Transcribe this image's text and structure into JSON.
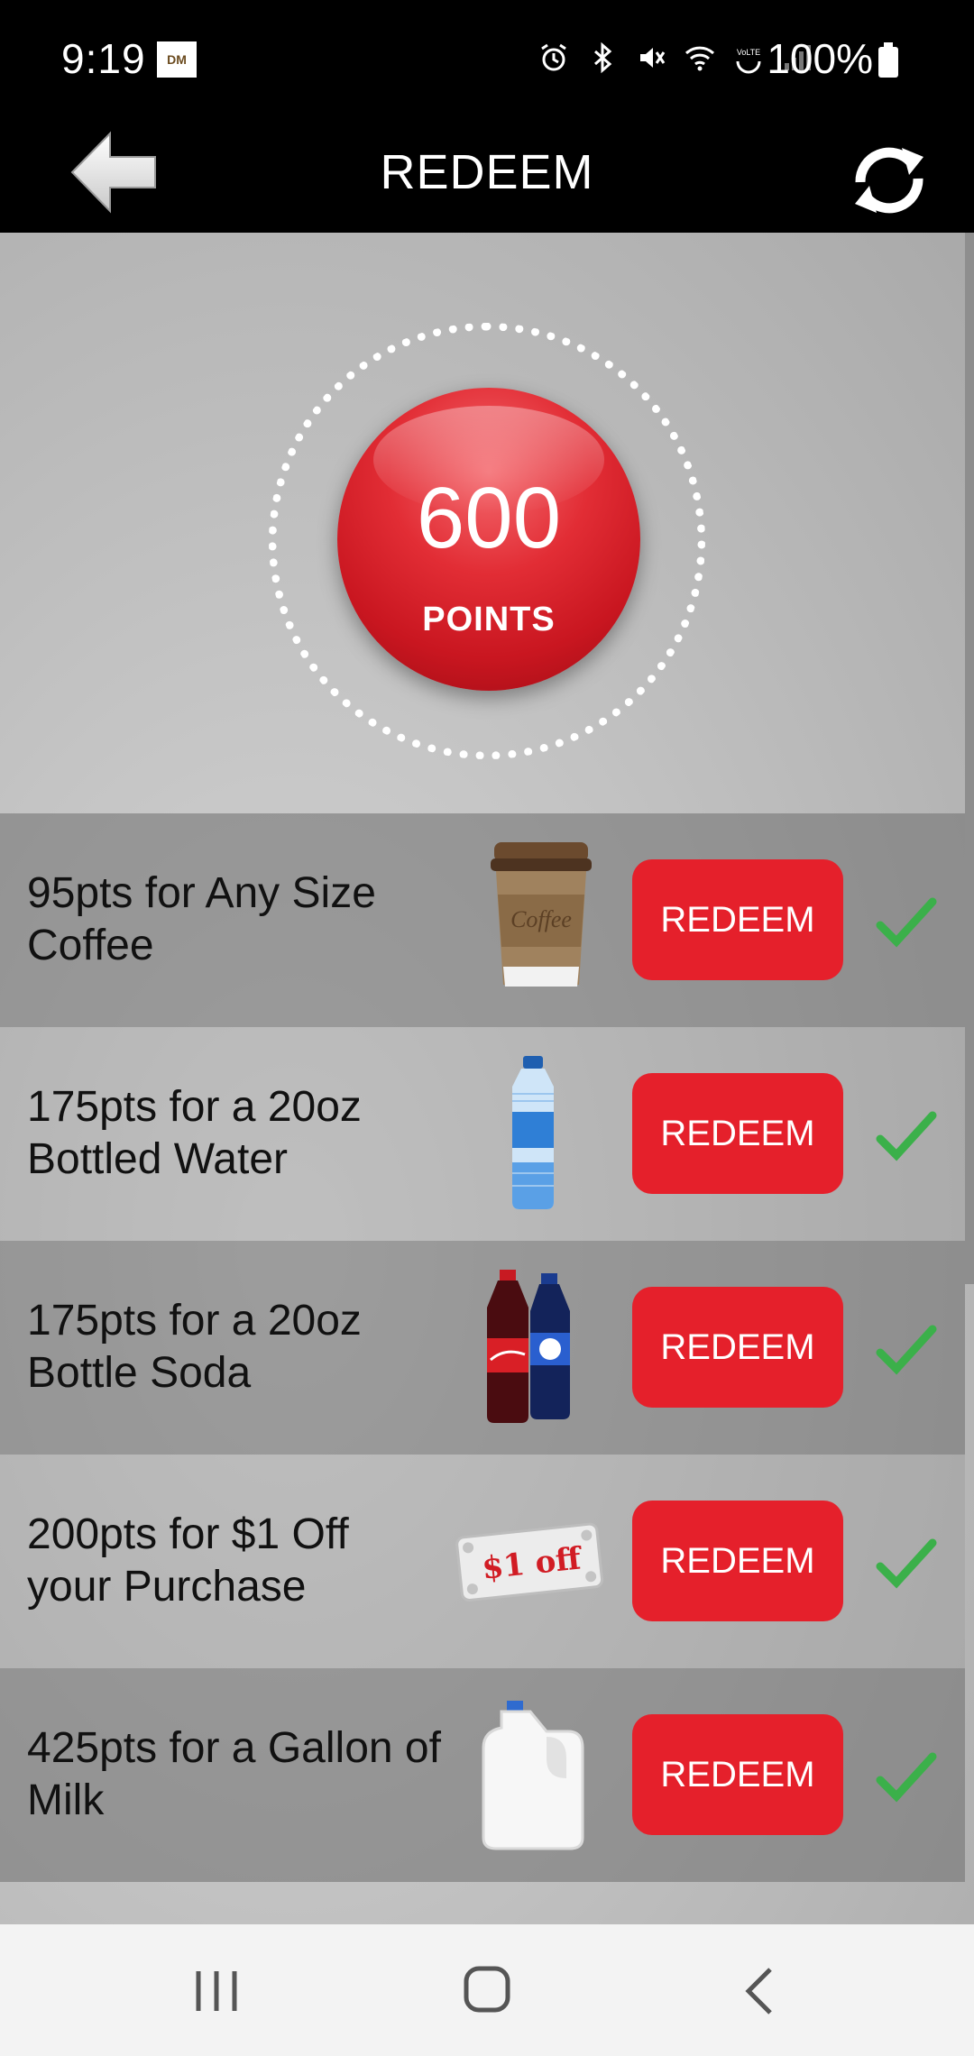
{
  "status_bar": {
    "time": "9:19",
    "app_badge": "DM",
    "battery": "100%"
  },
  "header": {
    "title": "REDEEM",
    "back_icon": "back-arrow-icon",
    "refresh_icon": "refresh-icon"
  },
  "points": {
    "value": "600",
    "label": "POINTS"
  },
  "rewards": [
    {
      "text": "95pts for Any Size Coffee",
      "image": "coffee-cup-image",
      "button": "REDEEM"
    },
    {
      "text": "175pts for a 20oz Bottled Water",
      "image": "water-bottle-image",
      "button": "REDEEM"
    },
    {
      "text": "175pts for a 20oz Bottle Soda",
      "image": "soda-bottles-image",
      "button": "REDEEM"
    },
    {
      "text": "200pts for $1 Off your Purchase",
      "image": "dollar-off-coupon-image",
      "button": "REDEEM"
    },
    {
      "text": "425pts for a Gallon of Milk",
      "image": "milk-gallon-image",
      "button": "REDEEM"
    }
  ],
  "coupon_text": "$1 off",
  "coffee_label": "Coffee",
  "colors": {
    "accent": "#e5202b",
    "check": "#3bb04a",
    "header_bg": "#000000"
  }
}
